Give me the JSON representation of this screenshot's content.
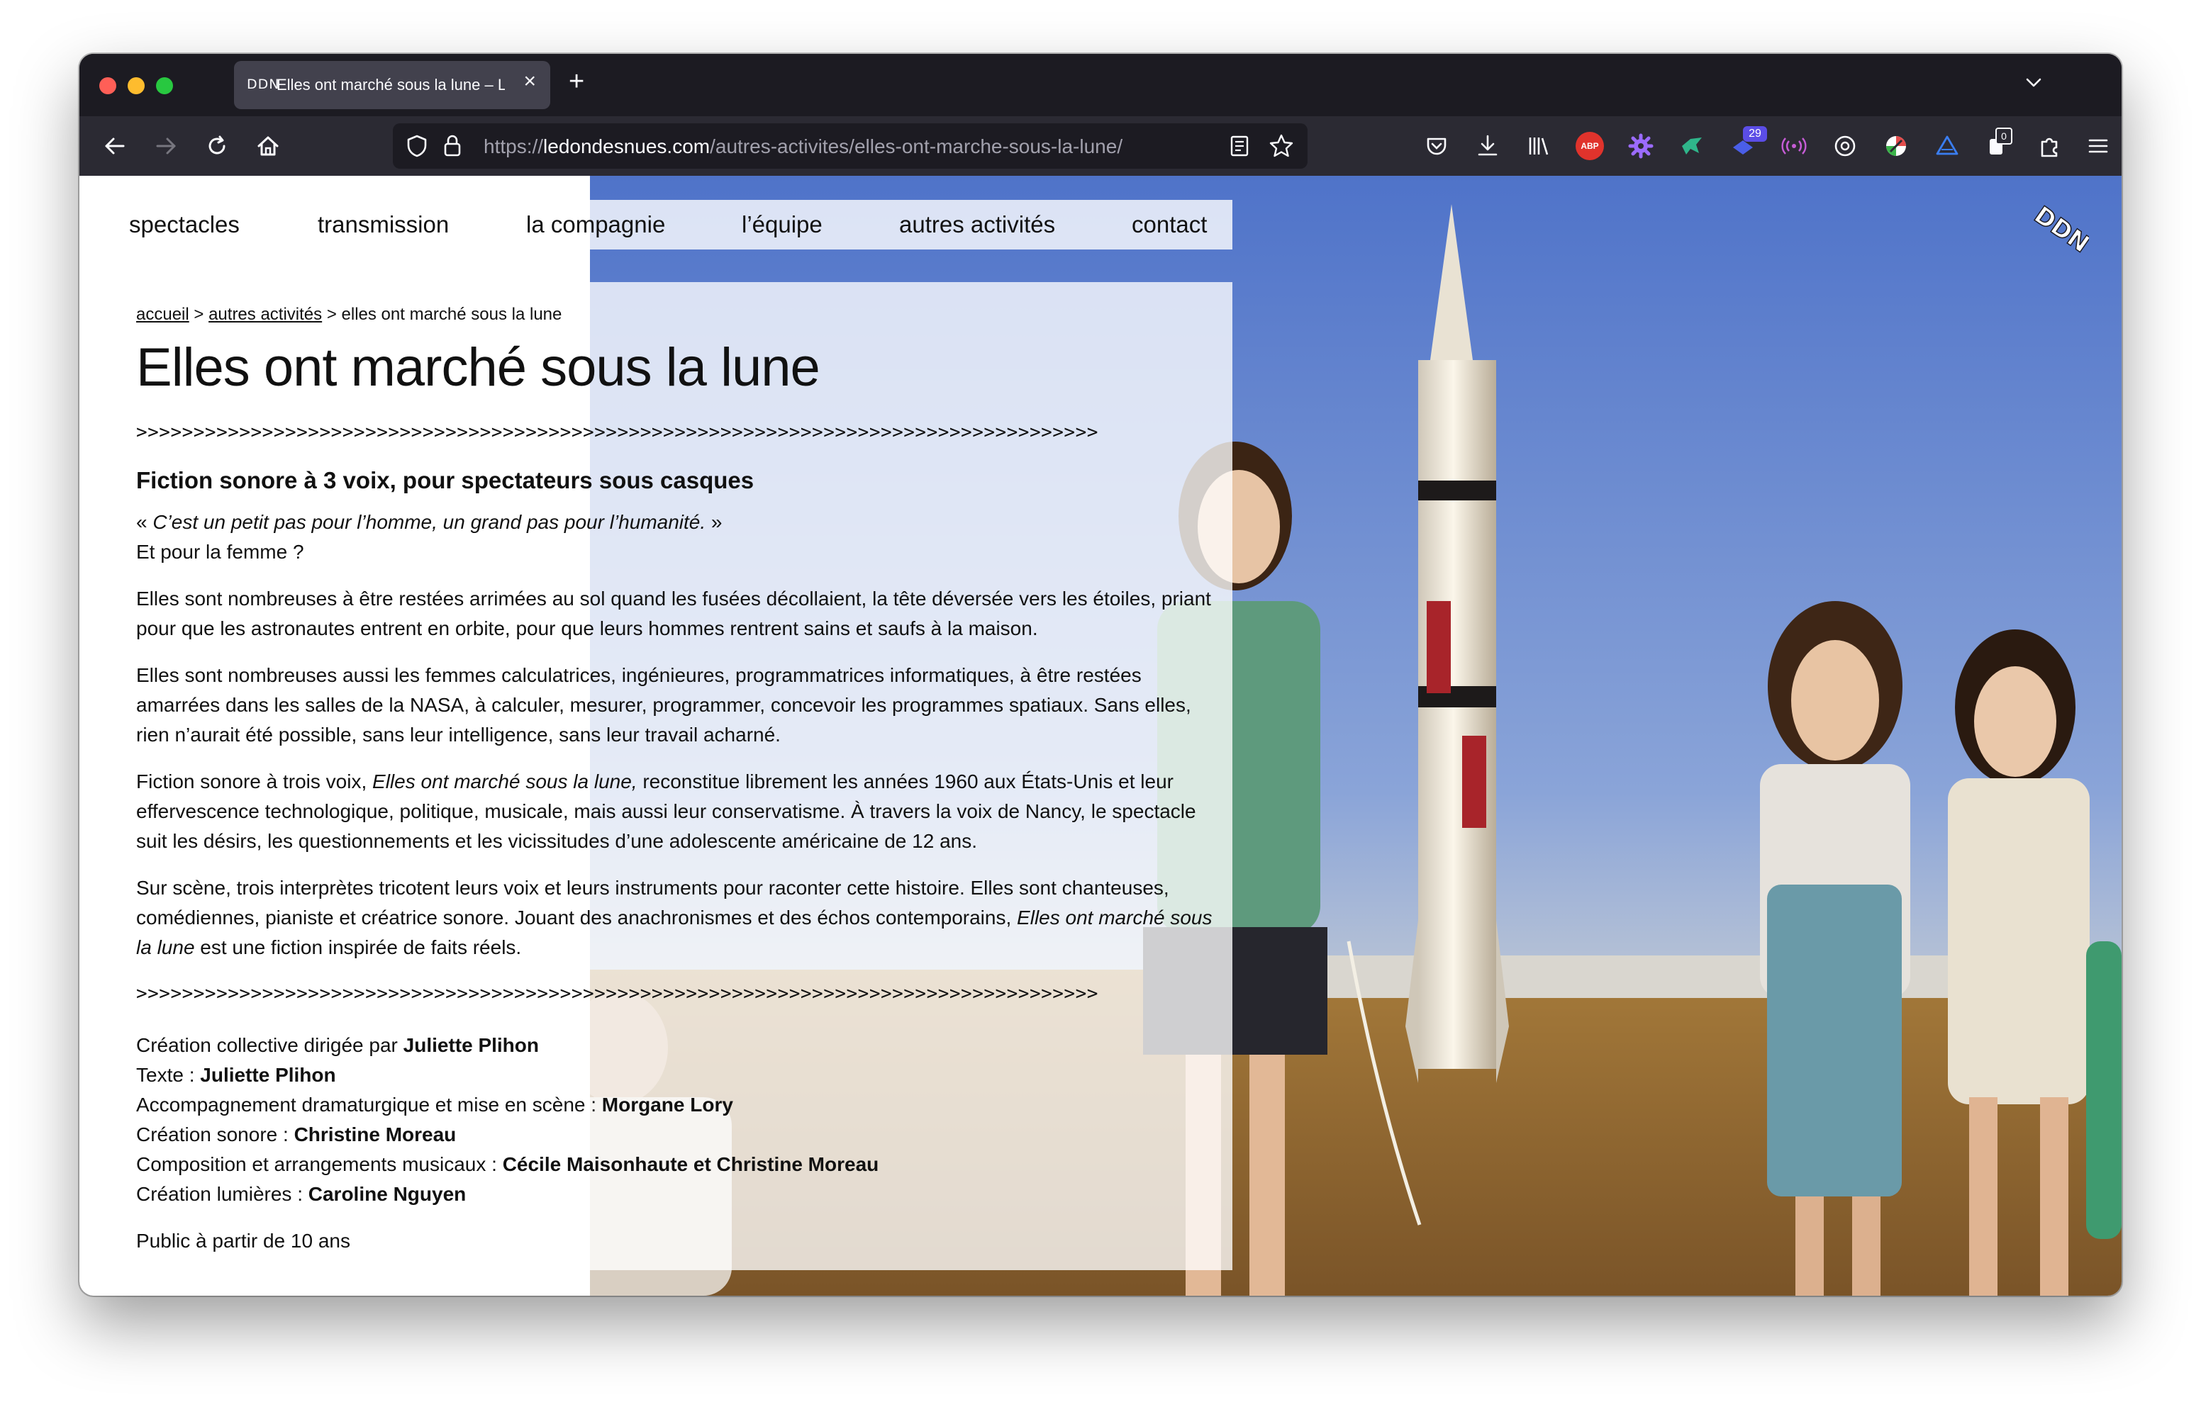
{
  "browser": {
    "tab_favicon": "DDN",
    "tab_title": "Elles ont marché sous la lune – Le Onde des Nues",
    "tab_close": "×",
    "new_tab": "+",
    "url_prefix": "https://",
    "url_domain": "ledondesnues.com",
    "url_path": "/autres-activites/elles-ont-marche-sous-la-lune/",
    "extension_badge_count": "29",
    "extension_counter": "0",
    "abp_label": "ABP"
  },
  "site": {
    "menu": [
      "spectacles",
      "transmission",
      "la compagnie",
      "l’équipe",
      "autres activités",
      "contact"
    ],
    "logo_text": "DDN"
  },
  "breadcrumb": {
    "home": "accueil",
    "sep1": " > ",
    "parent": "autres activités",
    "sep2": " > ",
    "current": "elles ont marché sous la lune"
  },
  "article": {
    "title": "Elles ont marché sous la lune",
    "separator": ">>>>>>>>>>>>>>>>>>>>>>>>>>>>>>>>>>>>>>>>>>>>>>>>>>>>>>>>>>>>>>>>>>>>>>>>>>>>>>>>>>>>",
    "subtitle": "Fiction sonore à 3 voix, pour spectateurs sous casques",
    "quote_open": "« ",
    "quote": "C’est un petit pas pour l’homme, un grand pas pour l’humanité.",
    "quote_close": " »",
    "quote_followup": "Et pour la femme ?",
    "p1": "Elles sont nombreuses à être restées arrimées au sol quand les fusées décollaient, la tête déversée vers les étoiles, priant pour que les astronautes entrent en orbite, pour que leurs hommes rentrent sains et saufs à la maison.",
    "p2": "Elles sont nombreuses aussi les femmes calculatrices, ingénieures, programmatrices informatiques, à être restées amarrées dans les salles de la NASA, à calculer, mesurer, programmer, concevoir les programmes spatiaux. Sans elles, rien n’aurait été possible, sans leur intelligence, sans leur travail acharné.",
    "p3_start": "Fiction sonore à trois voix, ",
    "p3_italic": "Elles ont marché sous la lune,",
    "p3_end": " reconstitue librement les années 1960 aux États-Unis et leur effervescence technologique, politique, musicale, mais aussi leur conservatisme. À travers la voix de Nancy, le spectacle suit les désirs, les questionnements et les vicissitudes d’une adolescente américaine de 12 ans.",
    "p4_start": "Sur scène, trois interprètes tricotent leurs voix et leurs instruments pour raconter cette histoire. Elles sont chanteuses, comédiennes, pianiste et créatrice sonore. Jouant des anachronismes et des échos contemporains, ",
    "p4_italic": "Elles ont marché sous la lune",
    "p4_end": " est une fiction inspirée de faits réels.",
    "credits": [
      {
        "label": "Création collective dirigée par ",
        "name": "Juliette Plihon"
      },
      {
        "label": "Texte : ",
        "name": "Juliette Plihon"
      },
      {
        "label": "Accompagnement dramaturgique et mise en scène : ",
        "name": "Morgane Lory"
      },
      {
        "label": "Création sonore : ",
        "name": "Christine Moreau"
      },
      {
        "label": "Composition et arrangements musicaux : ",
        "name": "Cécile Maisonhaute et Christine Moreau"
      },
      {
        "label": "Création lumières : ",
        "name": "Caroline Nguyen"
      }
    ],
    "audience": "Public à partir de 10 ans"
  }
}
